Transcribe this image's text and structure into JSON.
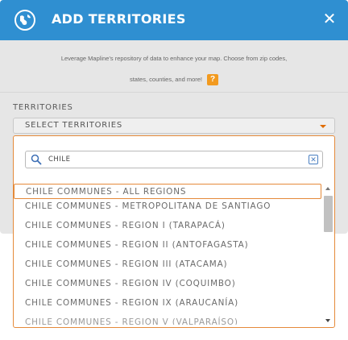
{
  "modal": {
    "title": "ADD TERRITORIES",
    "close_icon": "close-icon",
    "globe_icon": "globe-icon"
  },
  "description": {
    "line1": "Leverage Mapline's repository of data to enhance your map. Choose from zip codes,",
    "line2": "states, counties, and more!",
    "help_label": "?"
  },
  "territories": {
    "section_label": "TERRITORIES",
    "select_placeholder": "SELECT TERRITORIES"
  },
  "search": {
    "value": "CHILE",
    "icon": "search-icon",
    "clear_label": "✕"
  },
  "options": [
    "CHILE COMMUNES - ALL REGIONS",
    "CHILE COMMUNES - METROPOLITANA DE SANTIAGO",
    "CHILE COMMUNES - REGION I (TARAPACÁ)",
    "CHILE COMMUNES - REGION II (ANTOFAGASTA)",
    "CHILE COMMUNES - REGION III (ATACAMA)",
    "CHILE COMMUNES - REGION IV (COQUIMBO)",
    "CHILE COMMUNES - REGION IX (ARAUCANÍA)",
    "CHILE COMMUNES - REGION V (VALPARAÍSO)"
  ],
  "colors": {
    "header": "#2f8fd1",
    "accent": "#e58a3a",
    "help": "#f29a1f"
  }
}
